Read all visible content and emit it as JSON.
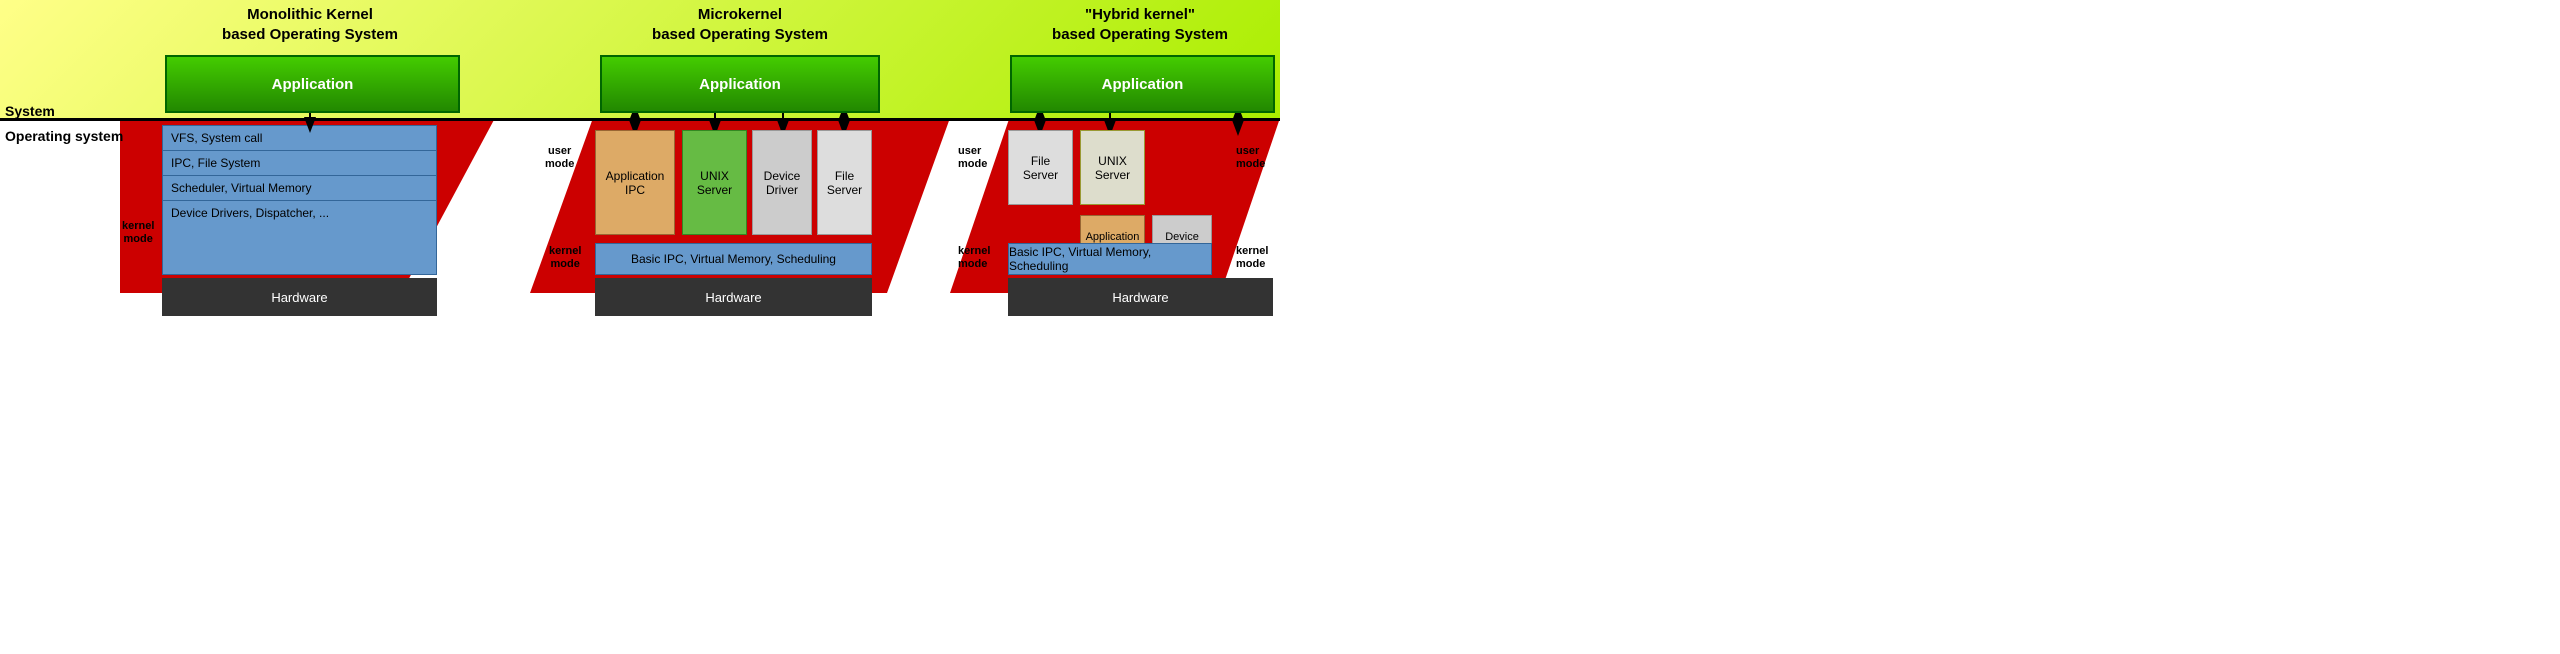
{
  "diagrams": {
    "d1": {
      "title": "Monolithic Kernel\nbased Operating System",
      "app_label": "Application",
      "kernel_mode": "kernel\nmode",
      "layers": [
        "VFS, System call",
        "IPC, File System",
        "Scheduler, Virtual Memory",
        "Device Drivers, Dispatcher, ..."
      ],
      "hardware": "Hardware"
    },
    "d2": {
      "title": "Microkernel\nbased Operating System",
      "app_label": "Application",
      "user_mode": "user\nmode",
      "kernel_mode": "kernel\nmode",
      "ipc_label": "Application\nIPC",
      "unix_label": "UNIX\nServer",
      "driver_label": "Device\nDriver",
      "file_label": "File\nServer",
      "blue_label": "Basic IPC, Virtual Memory, Scheduling",
      "hardware": "Hardware"
    },
    "d3": {
      "title": "\"Hybrid kernel\"\nbased Operating System",
      "app_label": "Application",
      "user_mode": "user\nmode",
      "kernel_mode": "kernel\nmode",
      "user_mode_right": "user\nmode",
      "kernel_mode_right": "kernel\nmode",
      "file_label": "File\nServer",
      "unix_label": "UNIX\nServer",
      "ipc_label": "Application\nIPC",
      "driver_label": "Device\nDriver",
      "blue_label": "Basic IPC, Virtual Memory, Scheduling",
      "hardware": "Hardware"
    }
  },
  "labels": {
    "system": "System",
    "os": "Operating system"
  }
}
